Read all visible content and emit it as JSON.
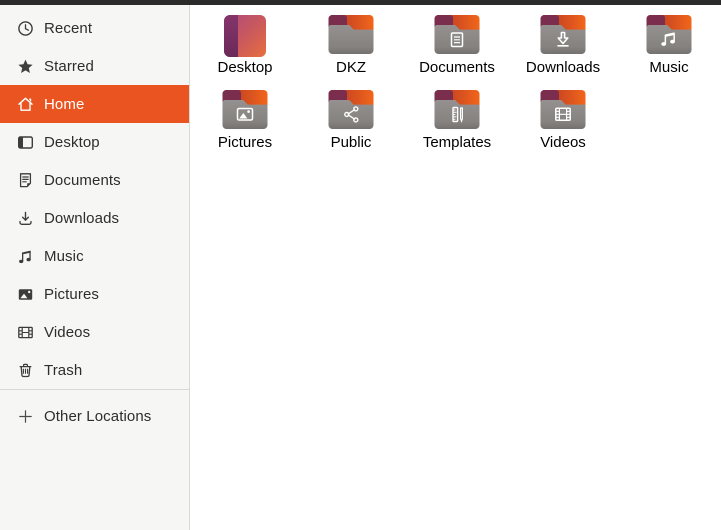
{
  "window": {
    "app": "Files file manager",
    "top_edge_color": "#2b2b2b"
  },
  "colors": {
    "accent_orange": "#E95420",
    "sidebar_bg": "#f6f6f5",
    "sidebar_divider": "#d9d9d9",
    "folder_gray": "#8a8785",
    "folder_tab_maroon": "#7b2d4d",
    "folder_back_orange": "#ee5f1c",
    "desktop_icon_purple": "#722d60",
    "main_bg": "#ffffff"
  },
  "sidebar": {
    "items": [
      {
        "label": "Recent",
        "icon": "clock-icon",
        "selected": false
      },
      {
        "label": "Starred",
        "icon": "star-icon",
        "selected": false
      },
      {
        "label": "Home",
        "icon": "home-icon",
        "selected": true
      },
      {
        "label": "Desktop",
        "icon": "desktop-icon",
        "selected": false
      },
      {
        "label": "Documents",
        "icon": "document-icon",
        "selected": false
      },
      {
        "label": "Downloads",
        "icon": "download-arrow-icon",
        "selected": false
      },
      {
        "label": "Music",
        "icon": "music-note-icon",
        "selected": false
      },
      {
        "label": "Pictures",
        "icon": "picture-icon",
        "selected": false
      },
      {
        "label": "Videos",
        "icon": "film-strip-icon",
        "selected": false
      },
      {
        "label": "Trash",
        "icon": "trash-can-icon",
        "selected": false
      }
    ],
    "other_locations": {
      "label": "Other Locations",
      "icon": "plus-icon"
    }
  },
  "content": {
    "view": "icon-grid",
    "folders": [
      {
        "name": "Desktop",
        "icon": "desktop-gradient-tile-icon"
      },
      {
        "name": "DKZ",
        "icon": "plain-folder-icon"
      },
      {
        "name": "Documents",
        "icon": "folder-documents-emblem-icon"
      },
      {
        "name": "Downloads",
        "icon": "folder-downloads-emblem-icon"
      },
      {
        "name": "Music",
        "icon": "folder-music-emblem-icon"
      },
      {
        "name": "Pictures",
        "icon": "folder-pictures-emblem-icon"
      },
      {
        "name": "Public",
        "icon": "folder-share-emblem-icon"
      },
      {
        "name": "Templates",
        "icon": "folder-templates-emblem-icon"
      },
      {
        "name": "Videos",
        "icon": "folder-videos-emblem-icon"
      }
    ]
  }
}
